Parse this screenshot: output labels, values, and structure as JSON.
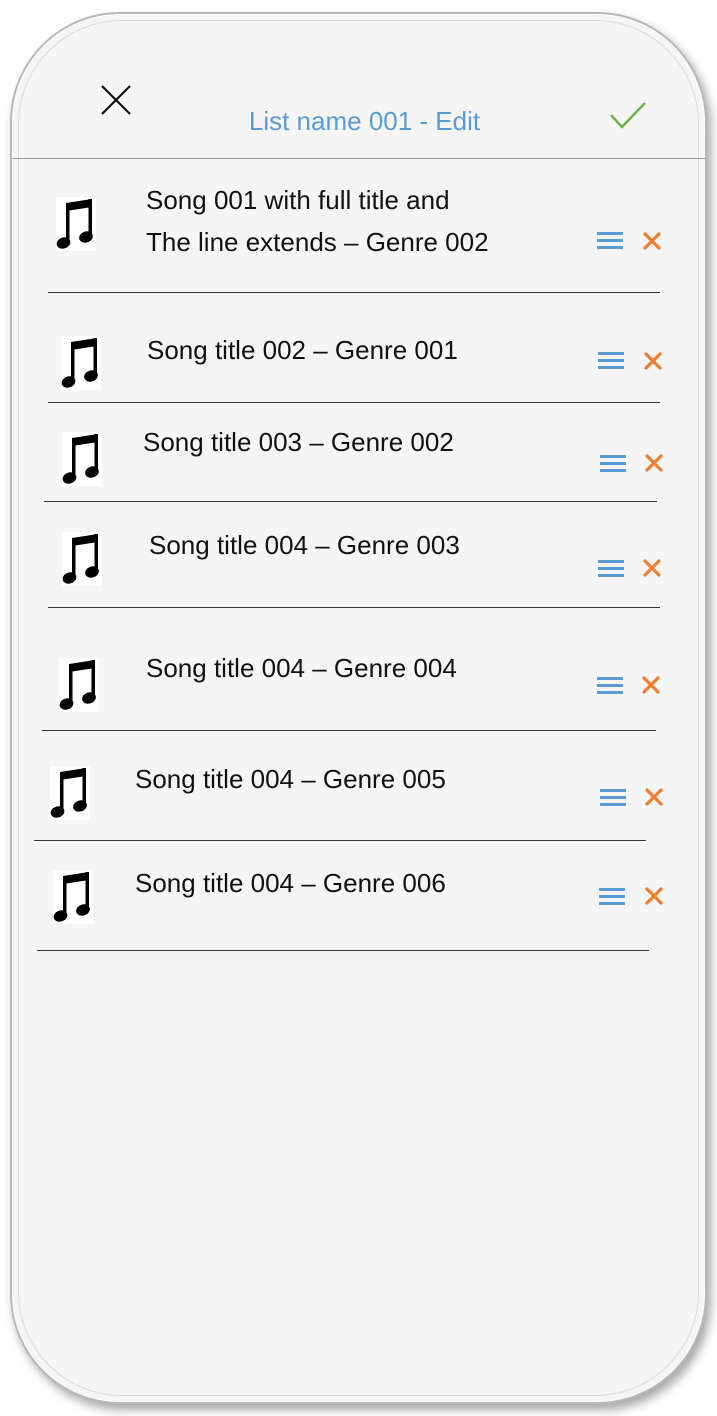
{
  "header": {
    "title": "List name 001 - Edit",
    "close_icon": "close-icon",
    "confirm_icon": "checkmark-icon"
  },
  "colors": {
    "accent": "#5b9bd5",
    "confirm": "#70ad47",
    "remove": "#ed7d31",
    "background": "#f5f5f5"
  },
  "songs": [
    {
      "line1": "Song 001 with full title and",
      "line2": "The line extends – Genre 002"
    },
    {
      "line1": "Song title 002 – Genre 001"
    },
    {
      "line1": "Song title 003 – Genre 002"
    },
    {
      "line1": "Song title 004 – Genre 003"
    },
    {
      "line1": "Song title 004 – Genre 004"
    },
    {
      "line1": "Song title 004 – Genre 005"
    },
    {
      "line1": "Song title 004 – Genre 006"
    }
  ]
}
